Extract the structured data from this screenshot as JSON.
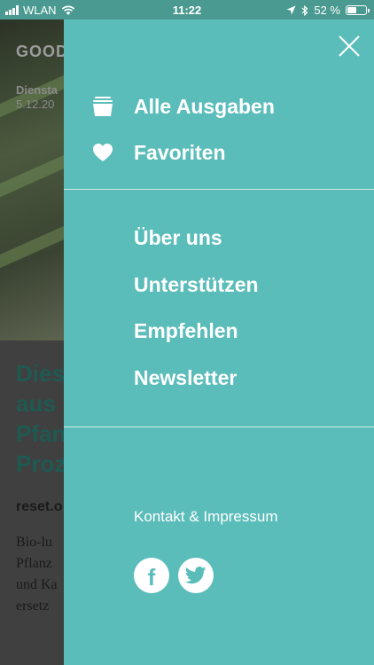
{
  "status_bar": {
    "carrier": "WLAN",
    "time": "11:22",
    "battery_percent": "52 %",
    "battery_level": 0.52
  },
  "background_article": {
    "brand": "GOOD",
    "day": "Diensta",
    "date": "5.12.20",
    "headline_lines": [
      "Dies",
      "aus",
      "Pfan",
      "Proz"
    ],
    "source": "reset.o",
    "body_lines": [
      "Bio-lu",
      "Pflanz",
      "und Ka",
      "ersetz"
    ]
  },
  "drawer": {
    "close_icon": "close-icon",
    "primary_items": [
      {
        "label": "Alle Ausgaben",
        "icon": "stack-icon"
      },
      {
        "label": "Favoriten",
        "icon": "heart-icon"
      }
    ],
    "secondary_items": [
      {
        "label": "Über uns"
      },
      {
        "label": "Unterstützen"
      },
      {
        "label": "Empfehlen"
      },
      {
        "label": "Newsletter"
      }
    ],
    "footer_link": "Kontakt & Impressum",
    "social": [
      {
        "network": "facebook",
        "icon": "facebook-icon",
        "glyph": "f"
      },
      {
        "network": "twitter",
        "icon": "twitter-icon"
      }
    ]
  },
  "colors": {
    "drawer_bg": "#5bbdba",
    "status_bar_bg": "#4a9a91",
    "headline": "#1f5a52"
  }
}
